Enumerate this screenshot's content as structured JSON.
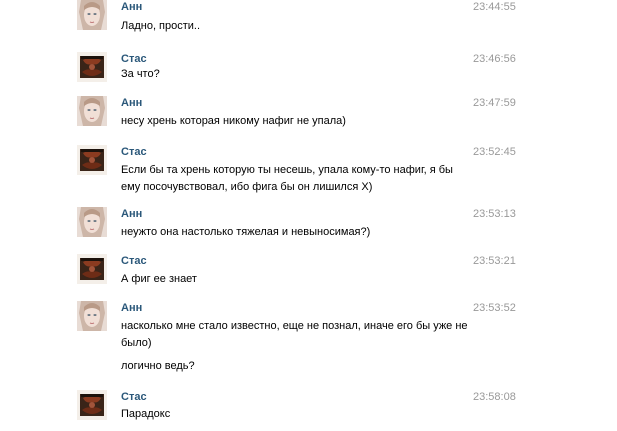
{
  "messages": [
    {
      "author": "Анн",
      "avatar": "ann-avatar",
      "time": "23:44:55",
      "lines": [
        "Ладно, прости.."
      ]
    },
    {
      "author": "Стас",
      "avatar": "stas-avatar",
      "time": "23:46:56",
      "lines": [
        "За что?"
      ]
    },
    {
      "author": "Анн",
      "avatar": "ann-avatar",
      "time": "23:47:59",
      "lines": [
        "несу хрень которая никому нафиг не упала)"
      ]
    },
    {
      "author": "Стас",
      "avatar": "stas-avatar",
      "time": "23:52:45",
      "lines": [
        "Если бы та хрень которую ты несешь, упала кому-то нафиг, я бы",
        "ему посочувствовал, ибо фига бы он лишился Х)"
      ]
    },
    {
      "author": "Анн",
      "avatar": "ann-avatar",
      "time": "23:53:13",
      "lines": [
        "неужто она настолько тяжелая и невыносимая?)"
      ]
    },
    {
      "author": "Стас",
      "avatar": "stas-avatar",
      "time": "23:53:21",
      "lines": [
        "А фиг ее знает"
      ]
    },
    {
      "author": "Анн",
      "avatar": "ann-avatar",
      "time": "23:53:52",
      "lines": [
        "насколько мне стало известно, еще не познал, иначе его бы уже не",
        "было)",
        "логично ведь?"
      ]
    },
    {
      "author": "Стас",
      "avatar": "stas-avatar",
      "time": "23:58:08",
      "lines": [
        "Парадокс"
      ]
    }
  ],
  "colors": {
    "author": "#2b587a",
    "time": "#999999",
    "text": "#000000"
  }
}
